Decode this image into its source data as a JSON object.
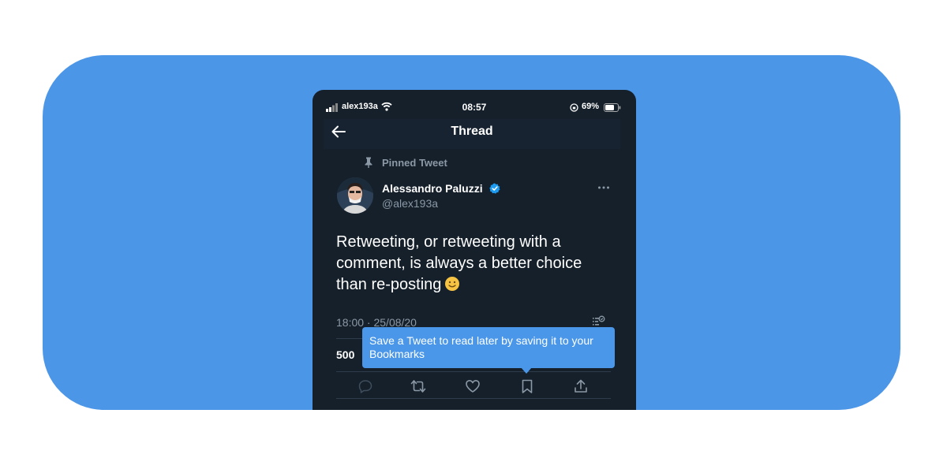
{
  "status_bar": {
    "carrier": "alex193a",
    "time": "08:57",
    "battery": "69%"
  },
  "nav": {
    "title": "Thread"
  },
  "tweet": {
    "pinned_label": "Pinned Tweet",
    "author_name": "Alessandro Paluzzi",
    "author_handle": "@alex193a",
    "text": "Retweeting, or retweeting with a comment, is always a better choice than re-posting",
    "emoji": "slightly-smiling-face",
    "timestamp": "18:00 · 25/08/20",
    "retweet_count": "500"
  },
  "tooltip": {
    "text": "Save a Tweet to read later by saving it to your Bookmarks"
  },
  "actions": [
    "reply-icon",
    "retweet-icon",
    "like-icon",
    "bookmark-icon",
    "share-icon"
  ],
  "colors": {
    "background_panel": "#4c96e8",
    "app_background": "#15202b",
    "tooltip": "#4a97e9",
    "verified": "#1d9bf0",
    "secondary_text": "#8b98a5"
  }
}
